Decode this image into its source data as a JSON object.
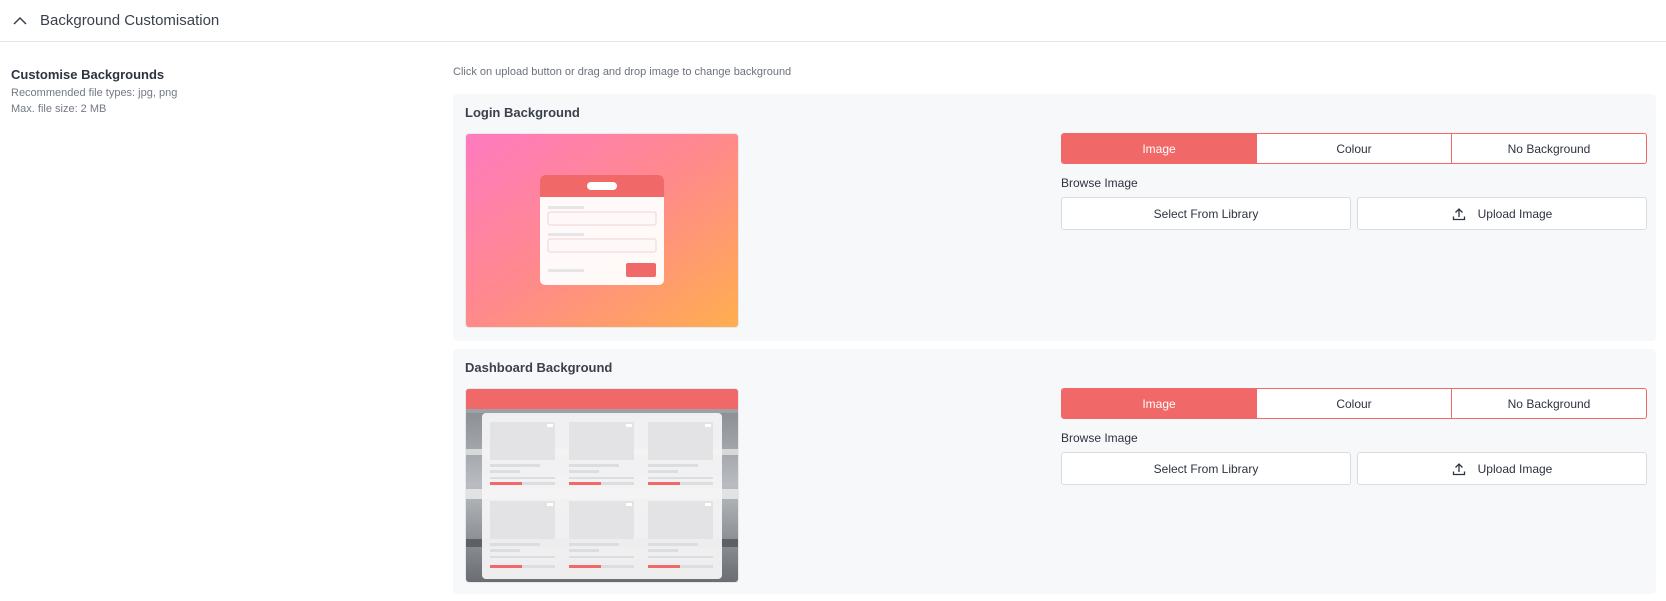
{
  "header": {
    "title": "Background Customisation",
    "collapse_icon": "chevron-up-icon"
  },
  "left_panel": {
    "heading": "Customise Backgrounds",
    "file_types": "Recommended file types: jpg, png",
    "max_size": "Max. file size: 2 MB"
  },
  "hint": "Click on upload button or drag and drop image to change background",
  "login": {
    "title": "Login Background",
    "options": [
      "Image",
      "Colour",
      "No Background"
    ],
    "selected": "Image",
    "browse_label": "Browse Image",
    "library_button": "Select From Library",
    "upload_button": "Upload Image",
    "upload_icon": "upload-icon"
  },
  "dashboard": {
    "title": "Dashboard Background",
    "options": [
      "Image",
      "Colour",
      "No Background"
    ],
    "selected": "Image",
    "browse_label": "Browse Image",
    "library_button": "Select From Library",
    "upload_button": "Upload Image",
    "upload_icon": "upload-icon"
  },
  "colors": {
    "accent": "#f06868",
    "card_bg": "#f7f8fa",
    "border": "#d9dce1"
  }
}
